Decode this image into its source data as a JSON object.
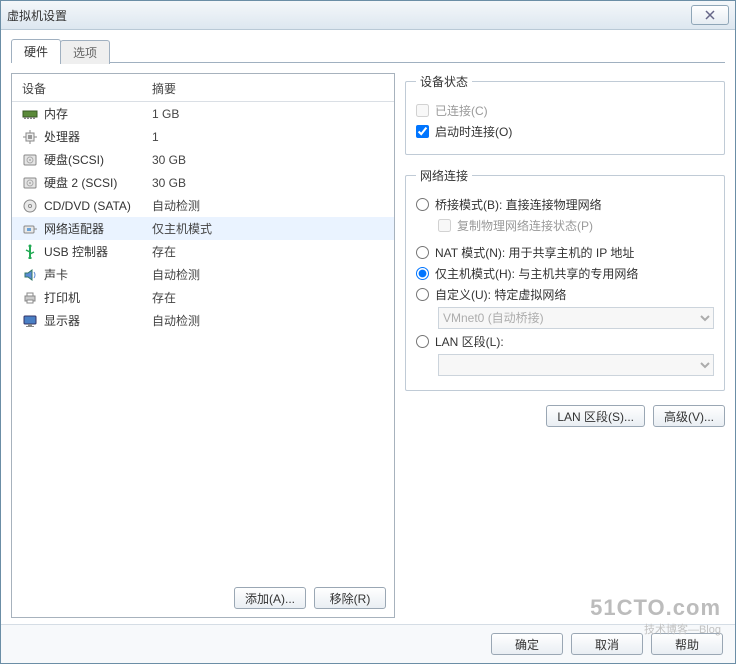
{
  "window": {
    "title": "虚拟机设置"
  },
  "tabs": {
    "hardware": "硬件",
    "options": "选项"
  },
  "left": {
    "headers": {
      "device": "设备",
      "summary": "摘要"
    },
    "items": [
      {
        "name": "内存",
        "summary": "1 GB",
        "icon": "memory"
      },
      {
        "name": "处理器",
        "summary": "1",
        "icon": "cpu"
      },
      {
        "name": "硬盘(SCSI)",
        "summary": "30 GB",
        "icon": "disk"
      },
      {
        "name": "硬盘 2 (SCSI)",
        "summary": "30 GB",
        "icon": "disk"
      },
      {
        "name": "CD/DVD (SATA)",
        "summary": "自动检测",
        "icon": "cd"
      },
      {
        "name": "网络适配器",
        "summary": "仅主机模式",
        "icon": "net"
      },
      {
        "name": "USB 控制器",
        "summary": "存在",
        "icon": "usb"
      },
      {
        "name": "声卡",
        "summary": "自动检测",
        "icon": "sound"
      },
      {
        "name": "打印机",
        "summary": "存在",
        "icon": "printer"
      },
      {
        "name": "显示器",
        "summary": "自动检测",
        "icon": "display"
      }
    ],
    "selected_index": 5,
    "add_btn": "添加(A)...",
    "remove_btn": "移除(R)"
  },
  "device_state": {
    "legend": "设备状态",
    "connected": "已连接(C)",
    "connect_at_power_on": "启动时连接(O)",
    "connected_checked": false,
    "connect_at_power_on_checked": true
  },
  "net": {
    "legend": "网络连接",
    "bridged": "桥接模式(B): 直接连接物理网络",
    "replicate": "复制物理网络连接状态(P)",
    "nat": "NAT 模式(N): 用于共享主机的 IP 地址",
    "hostonly": "仅主机模式(H): 与主机共享的专用网络",
    "custom": "自定义(U): 特定虚拟网络",
    "vmnet_placeholder": "VMnet0 (自动桥接)",
    "lan_segment": "LAN 区段(L):",
    "selected": "hostonly",
    "lan_segments_btn": "LAN 区段(S)...",
    "advanced_btn": "高级(V)..."
  },
  "footer": {
    "ok": "确定",
    "cancel": "取消",
    "help": "帮助"
  },
  "watermark": {
    "big": "51CTO.com",
    "small": "技术博客—Blog"
  }
}
